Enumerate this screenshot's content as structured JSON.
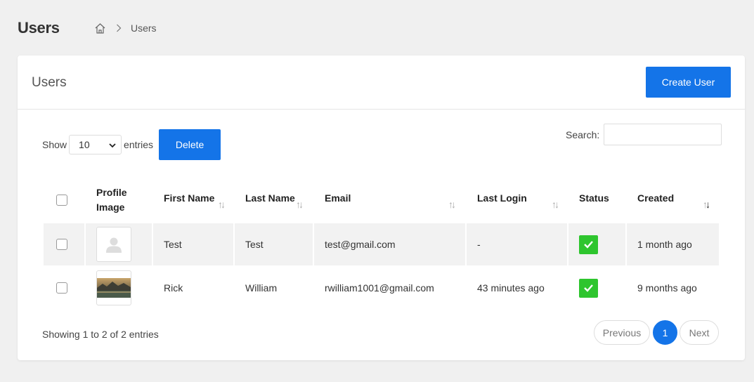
{
  "page": {
    "title": "Users"
  },
  "breadcrumb": {
    "current": "Users",
    "home_icon": "home-icon",
    "separator_icon": "chevron-right-icon"
  },
  "card": {
    "title": "Users",
    "create_button": "Create User"
  },
  "controls": {
    "show_label": "Show",
    "entries_value": "10",
    "entries_label": "entries",
    "delete_button": "Delete",
    "search_label": "Search:",
    "search_value": ""
  },
  "table": {
    "headers": {
      "profile_image_line1": "Profile",
      "profile_image_line2": "Image",
      "first_name": "First Name",
      "last_name": "Last Name",
      "email": "Email",
      "last_login": "Last Login",
      "status": "Status",
      "created": "Created"
    },
    "rows": [
      {
        "first_name": "Test",
        "last_name": "Test",
        "email": "test@gmail.com",
        "last_login": "-",
        "status": "active",
        "created": "1 month ago",
        "image": "default-avatar"
      },
      {
        "first_name": "Rick",
        "last_name": "William",
        "email": "rwilliam1001@gmail.com",
        "last_login": "43 minutes ago",
        "status": "active",
        "created": "9 months ago",
        "image": "landscape-photo"
      }
    ]
  },
  "footer": {
    "info": "Showing 1 to 2 of 2 entries",
    "prev": "Previous",
    "page": "1",
    "next": "Next"
  },
  "colors": {
    "primary": "#1474e8",
    "status_active": "#2ec52e",
    "background": "#f0f0f0"
  }
}
